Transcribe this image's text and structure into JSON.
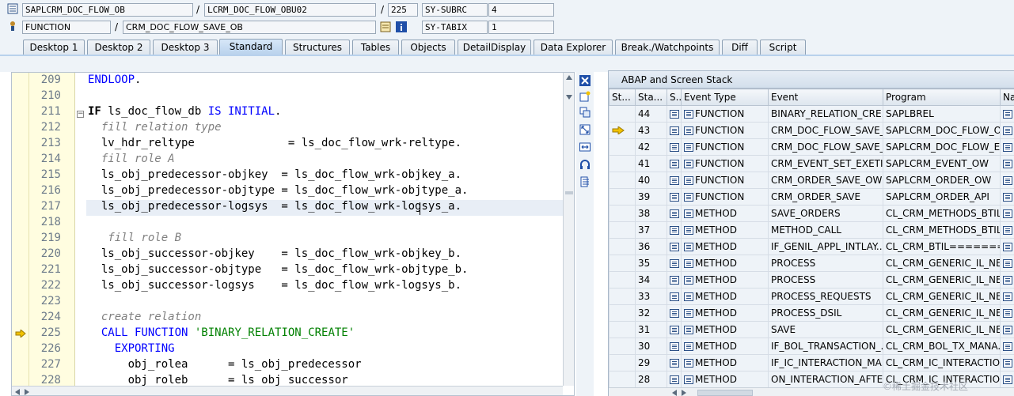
{
  "header": {
    "row1": {
      "program": "SAPLCRM_DOC_FLOW_OB",
      "include": "LCRM_DOC_FLOW_OBU02",
      "line": "225",
      "sysfield": "SY-SUBRC",
      "sysvalue": "4"
    },
    "row2": {
      "type": "FUNCTION",
      "name": "CRM_DOC_FLOW_SAVE_OB",
      "sysfield": "SY-TABIX",
      "sysvalue": "1"
    },
    "separator": "/"
  },
  "tabs": [
    "Desktop 1",
    "Desktop 2",
    "Desktop 3",
    "Standard",
    "Structures",
    "Tables",
    "Objects",
    "DetailDisplay",
    "Data Explorer",
    "Break./Watchpoints",
    "Diff",
    "Script"
  ],
  "active_tab": "Standard",
  "editor": {
    "lines": [
      {
        "n": "209",
        "segs": [
          [
            "kw",
            "ENDLOOP"
          ],
          [
            "",
            "."
          ]
        ]
      },
      {
        "n": "210",
        "segs": []
      },
      {
        "n": "211",
        "segs": [
          [
            "kwb",
            "IF"
          ],
          [
            "",
            " ls_doc_flow_db "
          ],
          [
            "kw",
            "IS INITIAL"
          ],
          [
            "",
            "."
          ]
        ]
      },
      {
        "n": "212",
        "segs": [
          [
            "cm",
            "  fill relation type"
          ]
        ]
      },
      {
        "n": "213",
        "segs": [
          [
            "",
            "  lv_hdr_reltype              = ls_doc_flow_wrk-reltype."
          ]
        ]
      },
      {
        "n": "214",
        "segs": [
          [
            "cm",
            "  fill role A"
          ]
        ]
      },
      {
        "n": "215",
        "segs": [
          [
            "",
            "  ls_obj_predecessor-objkey  = ls_doc_flow_wrk-objkey_a."
          ]
        ]
      },
      {
        "n": "216",
        "segs": [
          [
            "",
            "  ls_obj_predecessor-objtype = ls_doc_flow_wrk-objtype_a."
          ]
        ]
      },
      {
        "n": "217",
        "segs": [
          [
            "",
            "  ls_obj_predecessor-logsys  = ls_doc_flow_wrk-logsys_a."
          ]
        ]
      },
      {
        "n": "218",
        "segs": []
      },
      {
        "n": "219",
        "segs": [
          [
            "cm",
            "   fill role B"
          ]
        ]
      },
      {
        "n": "220",
        "segs": [
          [
            "",
            "  ls_obj_successor-objkey    = ls_doc_flow_wrk-objkey_b."
          ]
        ]
      },
      {
        "n": "221",
        "segs": [
          [
            "",
            "  ls_obj_successor-objtype   = ls_doc_flow_wrk-objtype_b."
          ]
        ]
      },
      {
        "n": "222",
        "segs": [
          [
            "",
            "  ls_obj_successor-logsys    = ls_doc_flow_wrk-logsys_b."
          ]
        ]
      },
      {
        "n": "223",
        "segs": []
      },
      {
        "n": "224",
        "segs": [
          [
            "cm",
            "  create relation"
          ]
        ]
      },
      {
        "n": "225",
        "segs": [
          [
            "",
            "  "
          ],
          [
            "kw",
            "CALL FUNCTION"
          ],
          [
            "",
            " "
          ],
          [
            "str",
            "'BINARY_RELATION_CREATE'"
          ]
        ]
      },
      {
        "n": "226",
        "segs": [
          [
            "",
            "    "
          ],
          [
            "kw",
            "EXPORTING"
          ]
        ]
      },
      {
        "n": "227",
        "segs": [
          [
            "",
            "      obj_rolea      = ls_obj_predecessor"
          ]
        ]
      },
      {
        "n": "228",
        "segs": [
          [
            "",
            "      obj_roleb      = ls_obj_successor"
          ]
        ]
      }
    ]
  },
  "stack": {
    "title": "ABAP and Screen Stack",
    "columns": [
      "St...",
      "Sta...",
      "S...",
      "Event Type",
      "Event",
      "Program",
      "Na..."
    ],
    "rows": [
      {
        "level": "44",
        "type": "FUNCTION",
        "event": "BINARY_RELATION_CRE...",
        "program": "SAPLBREL",
        "current": false
      },
      {
        "level": "43",
        "type": "FUNCTION",
        "event": "CRM_DOC_FLOW_SAVE_...",
        "program": "SAPLCRM_DOC_FLOW_O...",
        "current": true
      },
      {
        "level": "42",
        "type": "FUNCTION",
        "event": "CRM_DOC_FLOW_SAVE_...",
        "program": "SAPLCRM_DOC_FLOW_EC",
        "current": false
      },
      {
        "level": "41",
        "type": "FUNCTION",
        "event": "CRM_EVENT_SET_EXETI...",
        "program": "SAPLCRM_EVENT_OW",
        "current": false
      },
      {
        "level": "40",
        "type": "FUNCTION",
        "event": "CRM_ORDER_SAVE_OW",
        "program": "SAPLCRM_ORDER_OW",
        "current": false
      },
      {
        "level": "39",
        "type": "FUNCTION",
        "event": "CRM_ORDER_SAVE",
        "program": "SAPLCRM_ORDER_API",
        "current": false
      },
      {
        "level": "38",
        "type": "METHOD",
        "event": "SAVE_ORDERS",
        "program": "CL_CRM_METHODS_BTIL...",
        "current": false
      },
      {
        "level": "37",
        "type": "METHOD",
        "event": "METHOD_CALL",
        "program": "CL_CRM_METHODS_BTIL...",
        "current": false
      },
      {
        "level": "36",
        "type": "METHOD",
        "event": "IF_GENIL_APPL_INTLAY...",
        "program": "CL_CRM_BTIL=======...",
        "current": false
      },
      {
        "level": "35",
        "type": "METHOD",
        "event": "PROCESS",
        "program": "CL_CRM_GENERIC_IL_NE...",
        "current": false
      },
      {
        "level": "34",
        "type": "METHOD",
        "event": "PROCESS",
        "program": "CL_CRM_GENERIC_IL_NE...",
        "current": false
      },
      {
        "level": "33",
        "type": "METHOD",
        "event": "PROCESS_REQUESTS",
        "program": "CL_CRM_GENERIC_IL_NE...",
        "current": false
      },
      {
        "level": "32",
        "type": "METHOD",
        "event": "PROCESS_DSIL",
        "program": "CL_CRM_GENERIC_IL_NE...",
        "current": false
      },
      {
        "level": "31",
        "type": "METHOD",
        "event": "SAVE",
        "program": "CL_CRM_GENERIC_IL_NE...",
        "current": false
      },
      {
        "level": "30",
        "type": "METHOD",
        "event": "IF_BOL_TRANSACTION_...",
        "program": "CL_CRM_BOL_TX_MANA...",
        "current": false
      },
      {
        "level": "29",
        "type": "METHOD",
        "event": "IF_IC_INTERACTION_MA...",
        "program": "CL_CRM_IC_INTERACTIO...",
        "current": false
      },
      {
        "level": "28",
        "type": "METHOD",
        "event": "ON_INTERACTION_AFTE...",
        "program": "CL_CRM_IC_INTERACTIO...",
        "current": false
      }
    ]
  },
  "watermark": "©稀土掘金技术社区"
}
